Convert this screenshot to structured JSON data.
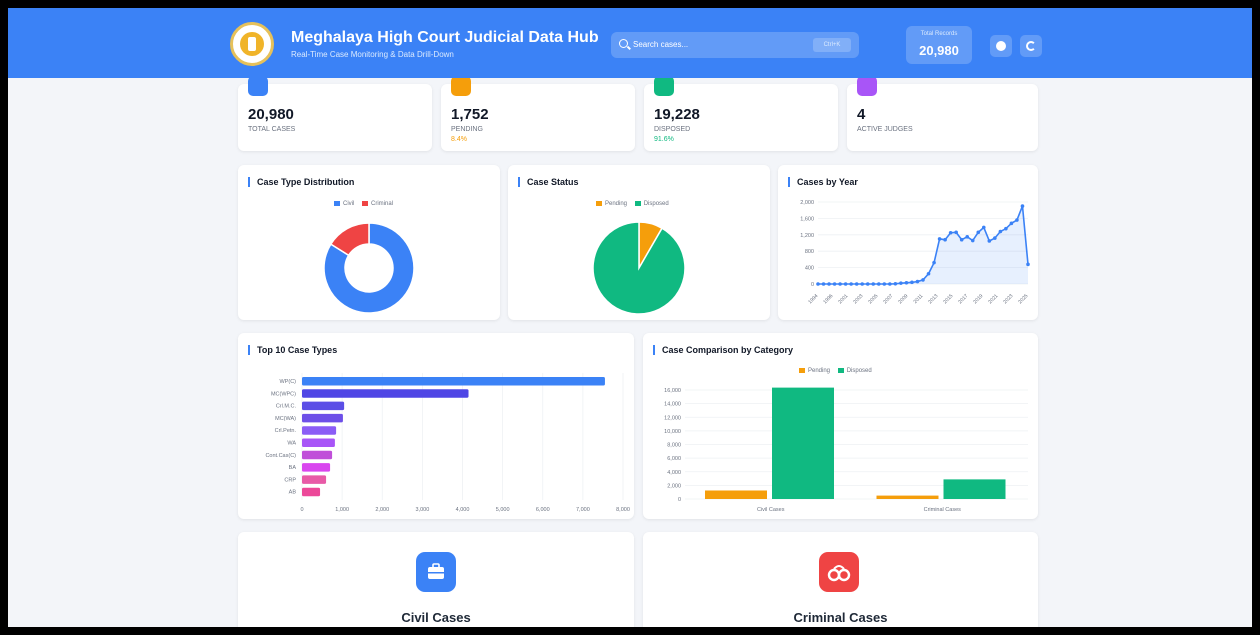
{
  "header": {
    "title": "Meghalaya High Court Judicial Data Hub",
    "subtitle": "Real-Time Case Monitoring & Data Drill-Down",
    "search_placeholder": "Search cases...",
    "search_shortcut": "Ctrl+K",
    "total_label": "Total Records",
    "total_value": "20,980",
    "brand_color": "#3b82f6"
  },
  "stats": [
    {
      "value": "20,980",
      "label": "TOTAL CASES",
      "icon": "file-icon",
      "color": "#3b82f6"
    },
    {
      "value": "1,752",
      "label": "PENDING",
      "pct": "8.4%",
      "icon": "clock-icon",
      "color": "#f59e0b"
    },
    {
      "value": "19,228",
      "label": "DISPOSED",
      "pct": "91.6%",
      "icon": "check-icon",
      "color": "#10b981"
    },
    {
      "value": "4",
      "label": "ACTIVE JUDGES",
      "icon": "gavel-icon",
      "color": "#a855f7"
    }
  ],
  "charts": {
    "case_type_title": "Case Type Distribution",
    "case_status_title": "Case Status",
    "cases_by_year_title": "Cases by Year",
    "top10_title": "Top 10 Case Types",
    "comparison_title": "Case Comparison by Category"
  },
  "chart_data": [
    {
      "type": "pie",
      "title": "Case Type Distribution",
      "donut": true,
      "labels": [
        "Civil",
        "Criminal"
      ],
      "values": [
        17600,
        3380
      ],
      "colors": [
        "#3b82f6",
        "#ef4444"
      ],
      "legend": "top"
    },
    {
      "type": "pie",
      "title": "Case Status",
      "labels": [
        "Pending",
        "Disposed"
      ],
      "values": [
        1752,
        19228
      ],
      "colors": [
        "#f59e0b",
        "#10b981"
      ],
      "legend": "top"
    },
    {
      "type": "area",
      "title": "Cases by Year",
      "x": [
        1990,
        1991,
        1992,
        1993,
        1994,
        1995,
        1996,
        1997,
        1998,
        1999,
        2000,
        2001,
        2002,
        2003,
        2004,
        2005,
        2006,
        2007,
        2008,
        2009,
        2010,
        2011,
        2012,
        2013,
        2014,
        2015,
        2016,
        2017,
        2018,
        2019,
        2020,
        2021,
        2022,
        2023,
        2024,
        2025
      ],
      "x_tick_labels": [
        "1994",
        "1996",
        "2001",
        "2003",
        "2005",
        "2007",
        "2009",
        "2011",
        "2013",
        "2015",
        "2017",
        "2019",
        "2021",
        "2023",
        "2025"
      ],
      "series": [
        {
          "values": [
            0,
            0,
            0,
            0,
            0,
            0,
            0,
            0,
            0,
            0,
            0,
            0,
            0,
            0,
            5,
            20,
            30,
            40,
            60,
            100,
            250,
            520,
            1100,
            1080,
            1250,
            1260,
            1080,
            1150,
            1060,
            1260,
            1380,
            1050,
            1120,
            1280,
            1350,
            1480,
            1560,
            1900,
            480
          ]
        }
      ],
      "yticks": [
        0,
        400,
        800,
        1200,
        1600,
        2000
      ],
      "yticklabels": [
        "0",
        "400",
        "800",
        "1,200",
        "1,600",
        "2,000"
      ],
      "ylim": [
        0,
        2000
      ],
      "color": "#3b82f6",
      "grid": true
    },
    {
      "type": "bar",
      "orientation": "horizontal",
      "title": "Top 10 Case Types",
      "categories": [
        "WP(C)",
        "MC(WPC)",
        "Crl.M.C.",
        "MC(WA)",
        "Crl.Petn.",
        "WA",
        "Cont.Cas(C)",
        "BA",
        "CRP",
        "AB"
      ],
      "values": [
        7550,
        4150,
        1050,
        1020,
        850,
        820,
        750,
        700,
        600,
        450
      ],
      "xticks": [
        0,
        1000,
        2000,
        3000,
        4000,
        5000,
        6000,
        7000,
        8000
      ],
      "xticklabels": [
        "0",
        "1,000",
        "2,000",
        "3,000",
        "4,000",
        "5,000",
        "6,000",
        "7,000",
        "8,000"
      ],
      "xlim": [
        0,
        8000
      ],
      "colors": [
        "#3b82f6",
        "#4f46e5",
        "#5b4ee6",
        "#6d4fe8",
        "#8b5cf6",
        "#a855f7",
        "#c04fd9",
        "#d946ef",
        "#e85aa7",
        "#ec4899"
      ]
    },
    {
      "type": "bar",
      "title": "Case Comparison by Category",
      "categories": [
        "Civil Cases",
        "Criminal Cases"
      ],
      "series": [
        {
          "name": "Pending",
          "values": [
            1250,
            500
          ],
          "color": "#f59e0b"
        },
        {
          "name": "Disposed",
          "values": [
            16350,
            2880
          ],
          "color": "#10b981"
        }
      ],
      "yticks": [
        0,
        2000,
        4000,
        6000,
        8000,
        10000,
        12000,
        14000,
        16000
      ],
      "yticklabels": [
        "0",
        "2,000",
        "4,000",
        "6,000",
        "8,000",
        "10,000",
        "12,000",
        "14,000",
        "16,000"
      ],
      "ylim": [
        0,
        16000
      ],
      "legend": "top",
      "grid": true
    }
  ],
  "categories_section": [
    {
      "title": "Civil Cases",
      "icon": "briefcase-icon",
      "color": "#3b82f6"
    },
    {
      "title": "Criminal Cases",
      "icon": "handcuffs-icon",
      "color": "#ef4444"
    }
  ]
}
